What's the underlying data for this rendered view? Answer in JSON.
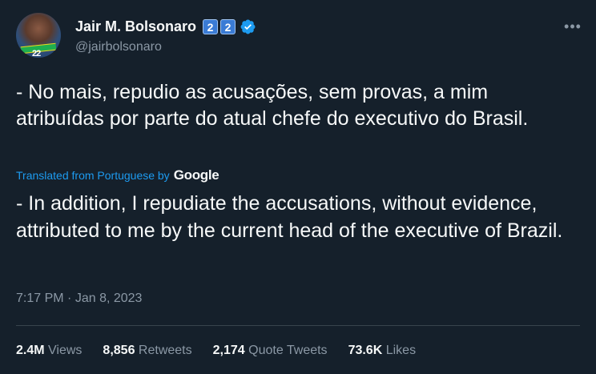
{
  "author": {
    "display_name": "Jair M. Bolsonaro",
    "badges": [
      "2",
      "2"
    ],
    "handle": "@jairbolsonaro",
    "avatar_number": "22"
  },
  "tweet": {
    "text": "- No mais, repudio as acusações, sem provas, a mim atribuídas por parte do atual chefe do executivo do Brasil.",
    "translated_label": "Translated from Portuguese by",
    "translated_provider": "Google",
    "translated_text": "- In addition, I repudiate the accusations, without evidence, attributed to me by the current head of the executive of Brazil.",
    "time": "7:17 PM",
    "separator": "·",
    "date": "Jan 8, 2023"
  },
  "stats": {
    "views": {
      "count": "2.4M",
      "label": "Views"
    },
    "retweets": {
      "count": "8,856",
      "label": "Retweets"
    },
    "quotes": {
      "count": "2,174",
      "label": "Quote Tweets"
    },
    "likes": {
      "count": "73.6K",
      "label": "Likes"
    }
  },
  "icons": {
    "verified": "verified-badge-icon",
    "more": "more-options-icon"
  },
  "colors": {
    "background": "#15202b",
    "link": "#1d9bf0",
    "secondary_text": "#8b98a5",
    "verified": "#1d9bf0"
  }
}
